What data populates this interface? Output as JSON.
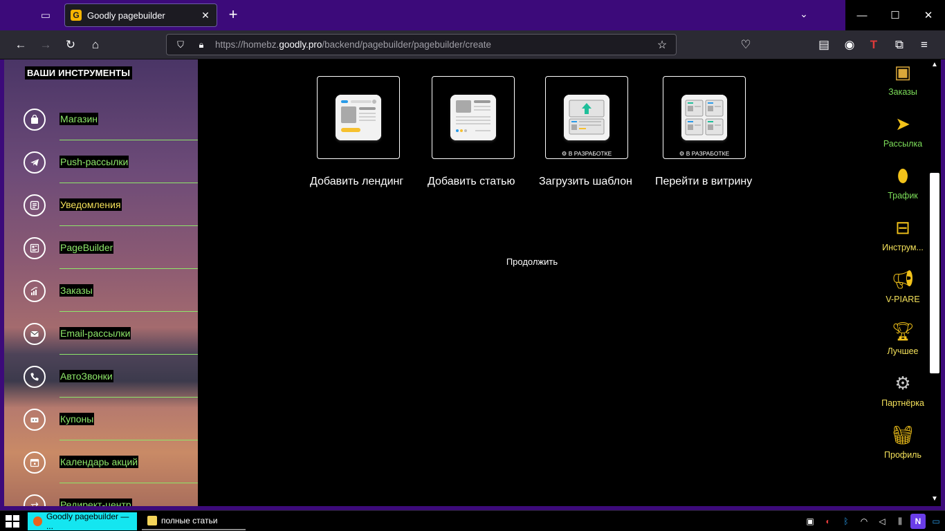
{
  "browser": {
    "tab_title": "Goodly pagebuilder",
    "favicon_letter": "G",
    "url_prefix": "https://homebz.",
    "url_domain": "goodly.pro",
    "url_path": "/backend/pagebuilder/pagebuilder/create"
  },
  "sidebar": {
    "heading": "ВАШИ ИНСТРУМЕНТЫ",
    "items": [
      {
        "label": "Магазин",
        "icon": "bag-icon"
      },
      {
        "label": "Push-рассылки",
        "icon": "telegram-icon"
      },
      {
        "label": "Уведомления",
        "icon": "notification-icon"
      },
      {
        "label": "PageBuilder",
        "icon": "pagebuilder-icon"
      },
      {
        "label": "Заказы",
        "icon": "chart-icon"
      },
      {
        "label": "Email-рассылки",
        "icon": "mail-icon"
      },
      {
        "label": "АвтоЗвонки",
        "icon": "phone-icon"
      },
      {
        "label": "Купоны",
        "icon": "coupon-icon"
      },
      {
        "label": "Календарь акций",
        "icon": "calendar-icon"
      },
      {
        "label": "Редирект-центр",
        "icon": "redirect-icon"
      }
    ]
  },
  "main": {
    "cards": [
      {
        "caption": "Добавить лендинг",
        "badge": ""
      },
      {
        "caption": "Добавить статью",
        "badge": ""
      },
      {
        "caption": "Загрузить шаблон",
        "badge": "⚙ В РАЗРАБОТКЕ"
      },
      {
        "caption": "Перейти в витрину",
        "badge": "⚙ В РАЗРАБОТКЕ"
      }
    ],
    "continue_label": "Продолжить"
  },
  "right_menu": {
    "items": [
      {
        "label": "Заказы",
        "icon": "boxes-icon",
        "color": "#7ddf5a"
      },
      {
        "label": "Рассылка",
        "icon": "paper-plane-icon",
        "color": "#7ddf5a"
      },
      {
        "label": "Трафик",
        "icon": "mouse-icon",
        "color": "#7ddf5a"
      },
      {
        "label": "Инструм...",
        "icon": "toolbox-icon",
        "color": "#f4e15a"
      },
      {
        "label": "V-PIARE",
        "icon": "megaphone-icon",
        "color": "#f4e15a"
      },
      {
        "label": "Лучшее",
        "icon": "trophy-icon",
        "color": "#f4e15a"
      },
      {
        "label": "Партнёрка",
        "icon": "gear-icon",
        "color": "#f4e15a"
      },
      {
        "label": "Профиль",
        "icon": "basket-icon",
        "color": "#f4e15a"
      }
    ]
  },
  "taskbar": {
    "items": [
      {
        "label": "Goodly pagebuilder — ..."
      },
      {
        "label": "полные статьи"
      }
    ]
  },
  "colors": {
    "accent_purple": "#3c0a7a",
    "menu_green": "#8ee86a",
    "menu_yellow": "#f4e15a",
    "taskbar_active": "#14e6f0"
  }
}
